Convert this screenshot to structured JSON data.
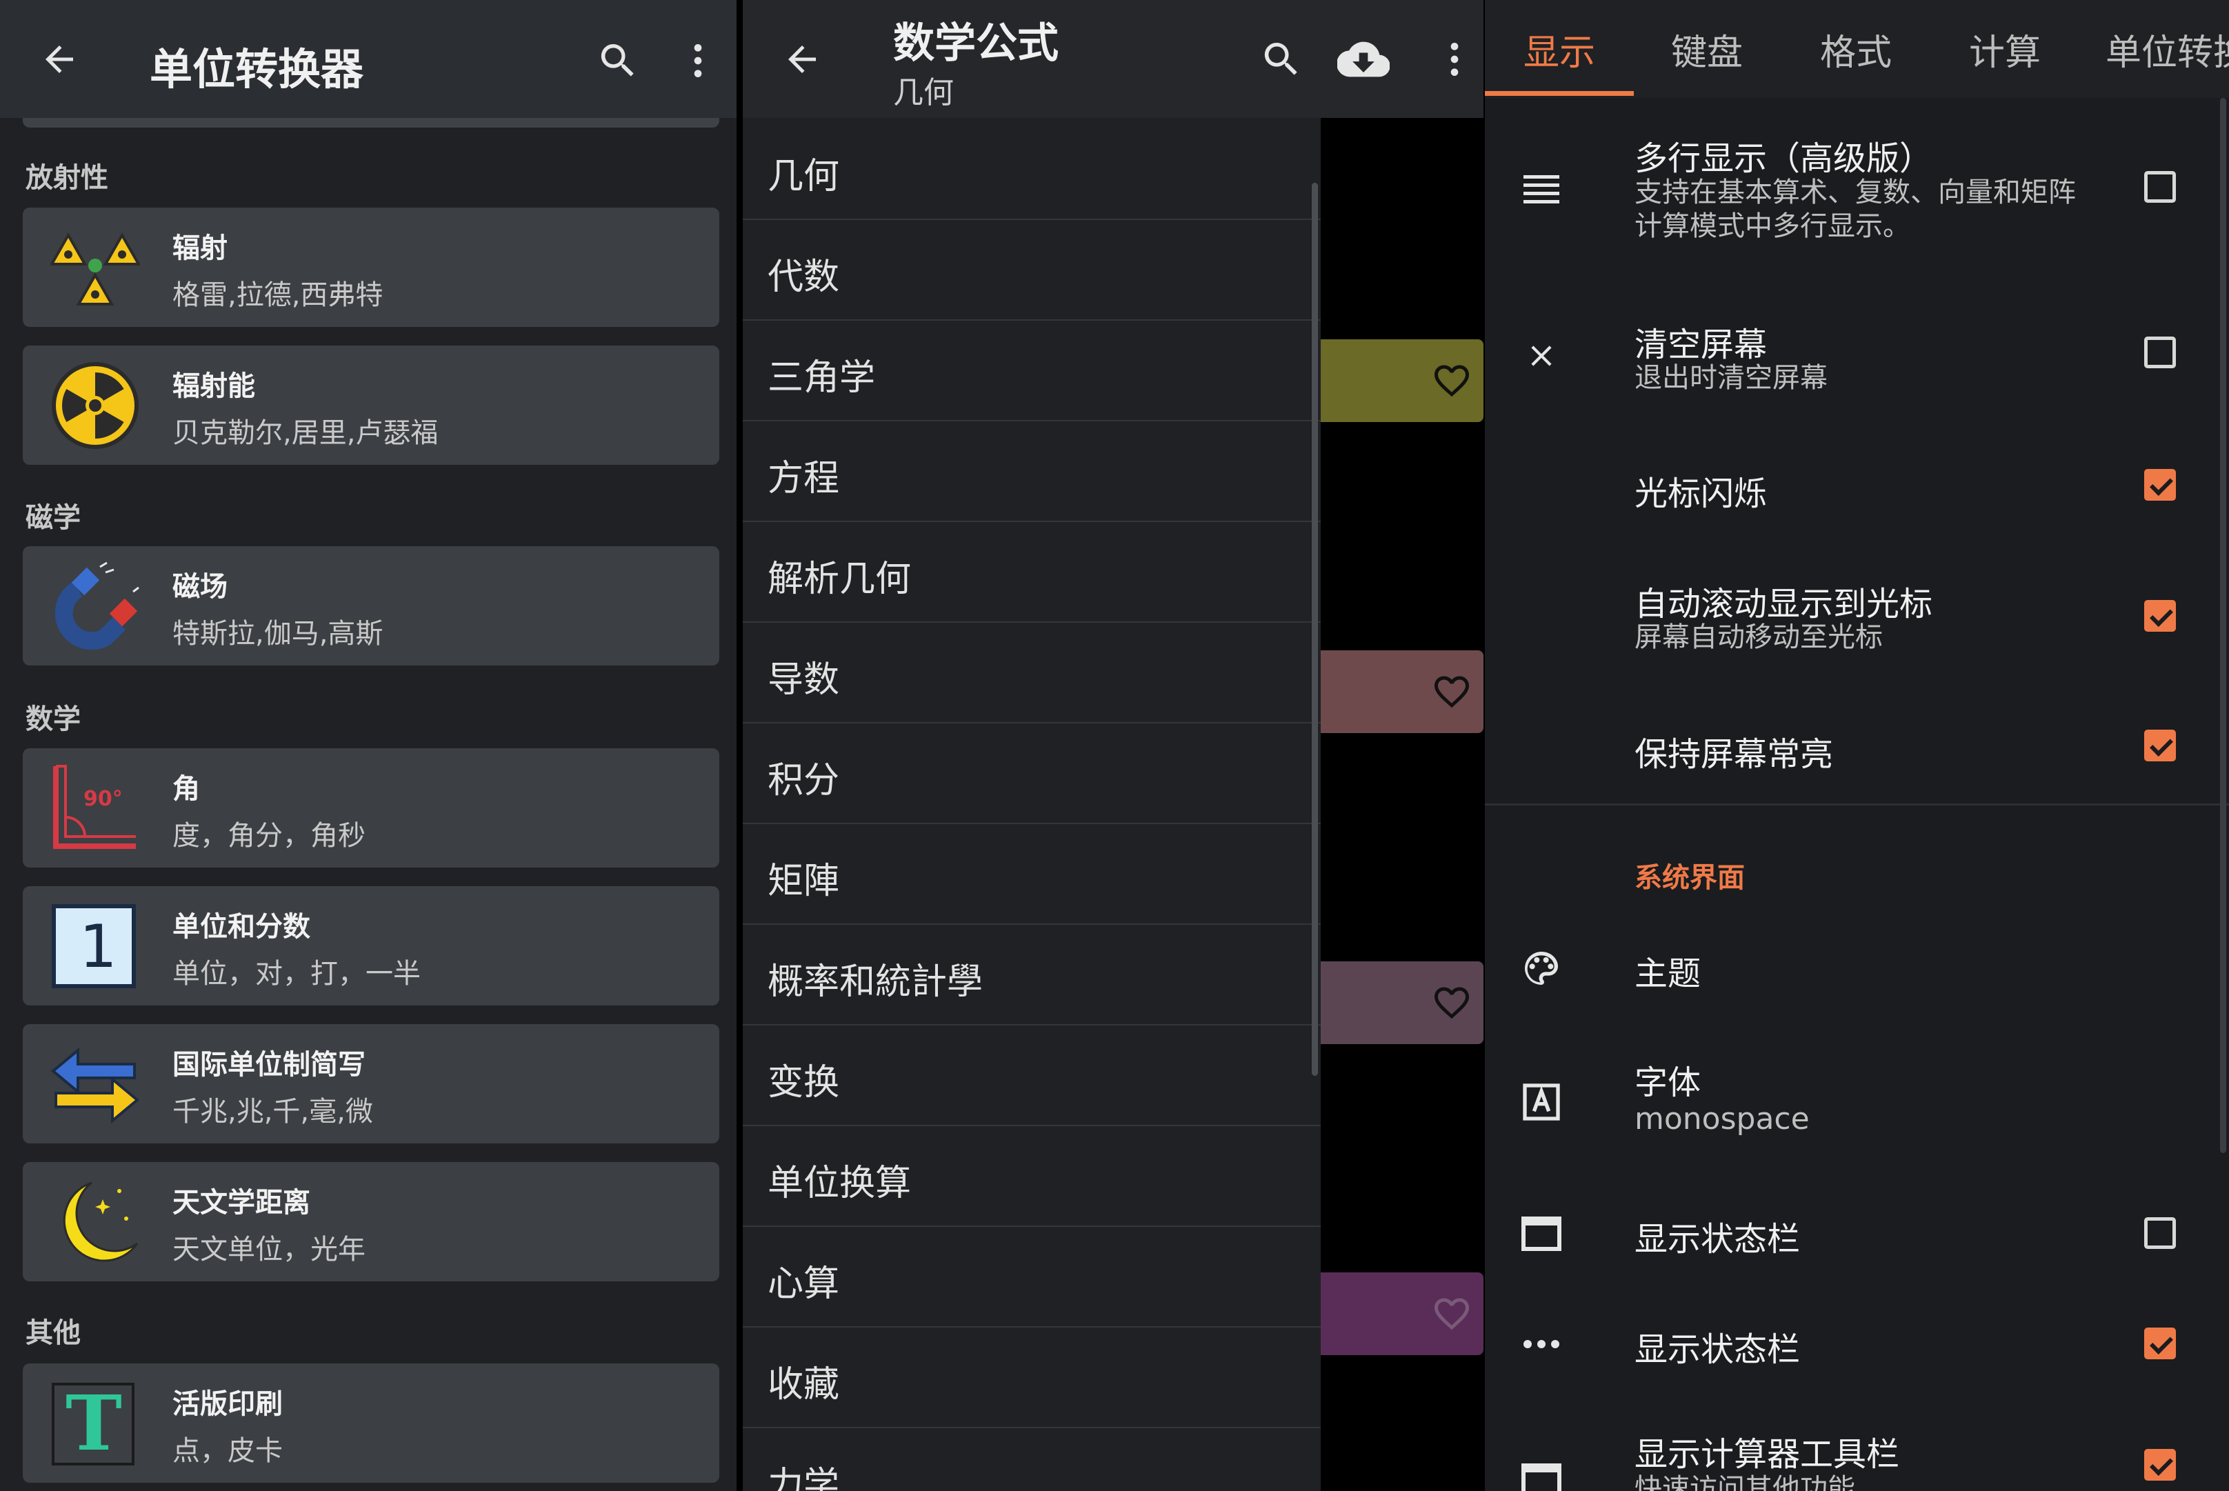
{
  "colors": {
    "accent": "#f07a47",
    "surface": "#3c3f43",
    "appbar": "#2b2e32"
  },
  "unit_converter": {
    "title": "单位转换器",
    "icons": {
      "back": "back-arrow-icon",
      "search": "search-icon",
      "more": "more-vert-icon"
    },
    "sections": [
      {
        "header": "放射性",
        "items": [
          {
            "title": "辐射",
            "subtitle": "格雷,拉德,西弗特",
            "icon": "radiation-trefoil-icon"
          },
          {
            "title": "辐射能",
            "subtitle": "贝克勒尔,居里,卢瑟福",
            "icon": "radiation-sign-icon"
          }
        ]
      },
      {
        "header": "磁学",
        "items": [
          {
            "title": "磁场",
            "subtitle": "特斯拉,伽马,高斯",
            "icon": "magnet-icon"
          }
        ]
      },
      {
        "header": "数学",
        "items": [
          {
            "title": "角",
            "subtitle": "度，角分，角秒",
            "icon": "angle-icon",
            "icon_text": "90°"
          },
          {
            "title": "单位和分数",
            "subtitle": "单位，对，打，一半",
            "icon": "number-one-icon",
            "icon_text": "1"
          },
          {
            "title": "国际单位制简写",
            "subtitle": "千兆,兆,千,毫,微",
            "icon": "arrows-exchange-icon"
          },
          {
            "title": "天文学距离",
            "subtitle": "天文单位，光年",
            "icon": "moon-icon"
          }
        ]
      },
      {
        "header": "其他",
        "items": [
          {
            "title": "活版印刷",
            "subtitle": "点，皮卡",
            "icon": "typography-icon",
            "icon_text": "T"
          }
        ]
      }
    ]
  },
  "math_formulas": {
    "title": "数学公式",
    "subtitle": "几何",
    "icons": {
      "back": "back-arrow-icon",
      "search": "search-icon",
      "download": "cloud-download-icon",
      "more": "more-vert-icon"
    },
    "drawer_items": [
      "几何",
      "代数",
      "三角学",
      "方程",
      "解析几何",
      "导数",
      "积分",
      "矩陣",
      "概率和統計學",
      "变换",
      "单位换算",
      "心算",
      "收藏",
      "力学"
    ],
    "favorite_cards": [
      {
        "color": "#6b6a26"
      },
      {
        "color": "#6e4a4d"
      },
      {
        "color": "#5c4552"
      },
      {
        "color": "#5a2d58"
      }
    ]
  },
  "settings": {
    "tabs": [
      "显示",
      "键盘",
      "格式",
      "计算",
      "单位转换"
    ],
    "active_tab": 0,
    "items": [
      {
        "title": "多行显示（高级版）",
        "subtitle_lines": [
          "支持在基本算术、复数、向量和矩阵",
          "计算模式中多行显示。"
        ],
        "icon": "multiline-icon",
        "checked": false
      },
      {
        "title": "清空屏幕",
        "subtitle_lines": [
          "退出时清空屏幕"
        ],
        "icon": "close-icon",
        "checked": false
      },
      {
        "title": "光标闪烁",
        "subtitle_lines": [],
        "icon": "",
        "checked": true
      },
      {
        "title": "自动滚动显示到光标",
        "subtitle_lines": [
          "屏幕自动移动至光标"
        ],
        "icon": "",
        "checked": true
      },
      {
        "title": "保持屏幕常亮",
        "subtitle_lines": [],
        "icon": "",
        "checked": true
      }
    ],
    "system_header": "系统界面",
    "system_items": [
      {
        "title": "主题",
        "subtitle": "",
        "icon": "palette-icon",
        "checkbox": null
      },
      {
        "title": "字体",
        "subtitle": "monospace",
        "icon": "font-icon",
        "checkbox": null
      },
      {
        "title": "显示状态栏",
        "subtitle": "",
        "icon": "window-icon",
        "checkbox": false
      },
      {
        "title": "显示状态栏",
        "subtitle": "",
        "icon": "more-horiz-icon",
        "checkbox": true
      },
      {
        "title": "显示计算器工具栏",
        "subtitle": "快速访问其他功能",
        "icon": "toolbar-window-icon",
        "checkbox": true
      }
    ]
  }
}
